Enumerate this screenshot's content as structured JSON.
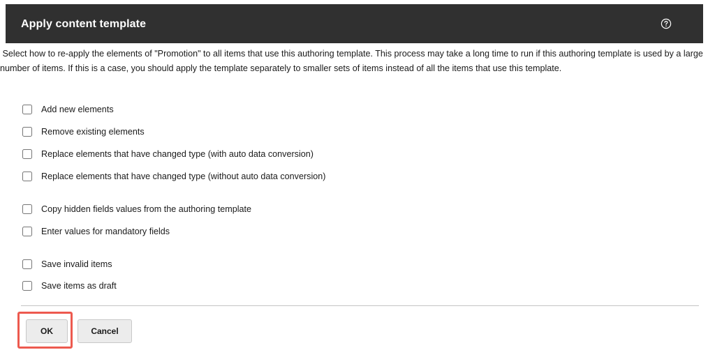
{
  "dialog": {
    "title": "Apply content template",
    "help_icon": "help-circle-icon",
    "description": " Select how to re-apply the elements of \"Promotion\" to all items that use this authoring template. This process may take a long time to run if this authoring template is used by a large number of items. If this is a case, you should apply the template separately to smaller sets of items instead of all the items that use this template."
  },
  "options": [
    {
      "label": "Add new elements",
      "checked": false
    },
    {
      "label": "Remove existing elements",
      "checked": false
    },
    {
      "label": "Replace elements that have changed type (with auto data conversion)",
      "checked": false
    },
    {
      "label": "Replace elements that have changed type (without auto data conversion)",
      "checked": false
    },
    {
      "label": "Copy hidden fields values from the authoring template",
      "checked": false
    },
    {
      "label": "Enter values for mandatory fields",
      "checked": false
    },
    {
      "label": "Save invalid items",
      "checked": false
    },
    {
      "label": "Save items as draft",
      "checked": false
    }
  ],
  "buttons": {
    "ok_label": "OK",
    "cancel_label": "Cancel"
  },
  "colors": {
    "header_bg": "#303030",
    "highlight": "#ed5a4f"
  }
}
